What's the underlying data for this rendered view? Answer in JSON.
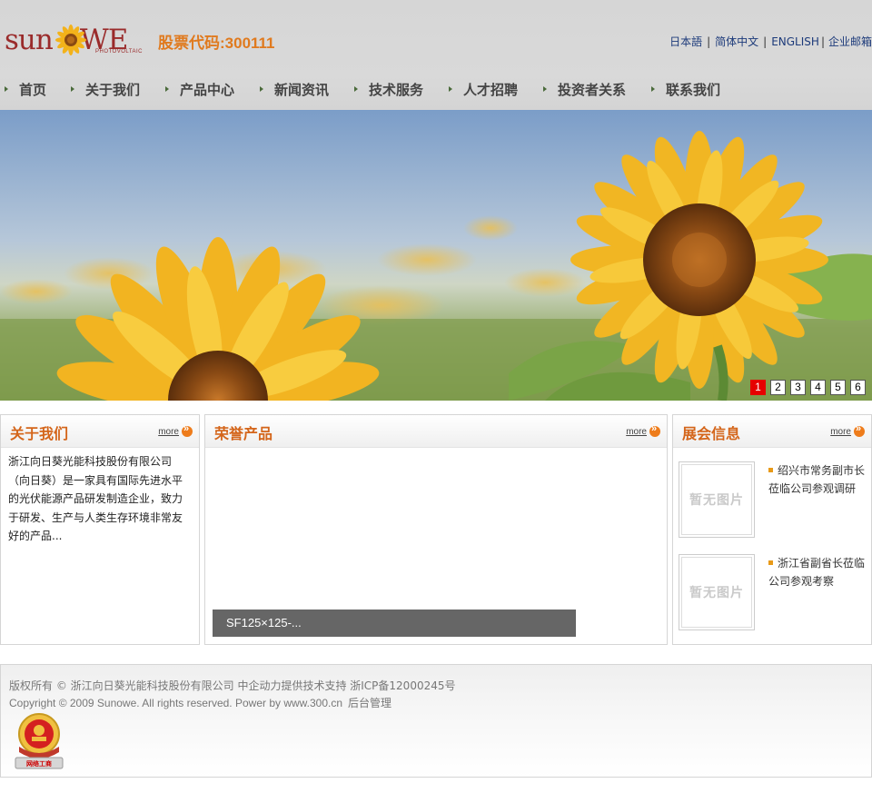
{
  "header": {
    "logo_text_left": "sun",
    "logo_text_right": "we",
    "logo_sub": "PHOTOVOLTAIC",
    "stock_code": "股票代码:300111",
    "languages": [
      "日本語",
      "简体中文",
      "ENGLISH",
      "企业邮箱"
    ]
  },
  "nav": {
    "items": [
      {
        "label": "首页"
      },
      {
        "label": "关于我们"
      },
      {
        "label": "产品中心"
      },
      {
        "label": "新闻资讯"
      },
      {
        "label": "技术服务"
      },
      {
        "label": "人才招聘"
      },
      {
        "label": "投资者关系"
      },
      {
        "label": "联系我们"
      }
    ]
  },
  "banner": {
    "pages": [
      "1",
      "2",
      "3",
      "4",
      "5",
      "6"
    ],
    "active_page": "1"
  },
  "about": {
    "title": "关于我们",
    "more": "more",
    "text": "浙江向日葵光能科技股份有限公司（向日葵）是一家具有国际先进水平的光伏能源产品研发制造企业，致力于研发、生产与人类生存环境非常友好的产品..."
  },
  "honor": {
    "title": "荣誉产品",
    "more": "more",
    "caption": "SF125×125-..."
  },
  "expo": {
    "title": "展会信息",
    "more": "more",
    "items": [
      {
        "thumb": "暂无图片",
        "text": "绍兴市常务副市长莅临公司参观调研"
      },
      {
        "thumb": "暂无图片",
        "text": "浙江省副省长莅临公司参观考察"
      }
    ]
  },
  "footer": {
    "line1": "版权所有 © 浙江向日葵光能科技股份有限公司  中企动力提供技术支持  浙ICP备12000245号",
    "line2": "Copyright © 2009 Sunowe. All rights reserved. Power by www.300.cn",
    "admin_link": "后台管理",
    "badge_text": "网络工商"
  },
  "colors": {
    "accent": "#d4651a",
    "stock": "#e07a1e",
    "link": "#1c3a7a",
    "pager_active": "#e60000"
  }
}
